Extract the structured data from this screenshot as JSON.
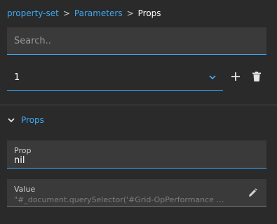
{
  "breadcrumb": {
    "root": "property-set",
    "parent": "Parameters",
    "current": "Props",
    "separator": ">"
  },
  "search": {
    "placeholder": "Search..",
    "value": ""
  },
  "selector": {
    "value": "1",
    "icon": "chevron-down-icon"
  },
  "actions": {
    "add_icon": "plus-icon",
    "delete_icon": "trash-icon"
  },
  "section": {
    "title": "Props",
    "expanded": true
  },
  "fields": {
    "prop": {
      "label": "Prop",
      "value": "nil"
    },
    "value": {
      "label": "Value",
      "value": "\"#_document.querySelector('#Grid-OpPerformance …",
      "icon": "pencil-icon"
    }
  },
  "colors": {
    "background": "#2a2a2a",
    "field_background": "#3a3a3a",
    "accent": "#3fa9f5"
  }
}
